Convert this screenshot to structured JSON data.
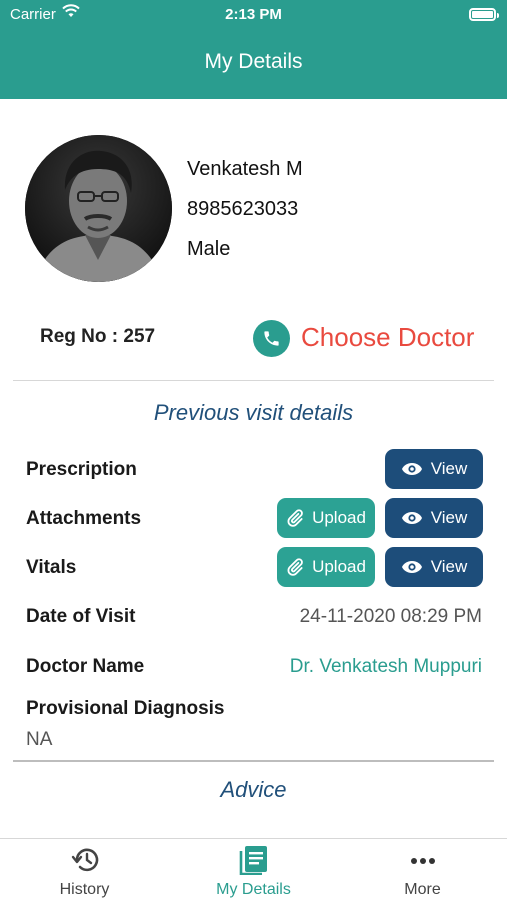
{
  "status_bar": {
    "carrier": "Carrier",
    "time": "2:13 PM"
  },
  "header": {
    "title": "My Details"
  },
  "patient": {
    "name": "Venkatesh M",
    "phone": "8985623033",
    "gender": "Male"
  },
  "reg_no": "Reg No : 257",
  "choose_doctor": "Choose Doctor",
  "previous_visit": {
    "title": "Previous visit details",
    "prescription_label": "Prescription",
    "attachments_label": "Attachments",
    "vitals_label": "Vitals",
    "view_label": "View",
    "upload_label": "Upload",
    "date_label": "Date of Visit",
    "date_value": "24-11-2020 08:29 PM",
    "doctor_label": "Doctor Name",
    "doctor_value": "Dr. Venkatesh Muppuri",
    "diagnosis_label": "Provisional Diagnosis",
    "diagnosis_value": "NA"
  },
  "advice": {
    "title": "Advice"
  },
  "tabs": [
    {
      "label": "History",
      "icon": "history-icon",
      "active": false
    },
    {
      "label": "My Details",
      "icon": "document-list-icon",
      "active": true
    },
    {
      "label": "More",
      "icon": "more-dots-icon",
      "active": false
    }
  ],
  "colors": {
    "primary": "#2a9d8f",
    "navy": "#1d4d7a",
    "accent_red": "#e94a3f"
  }
}
